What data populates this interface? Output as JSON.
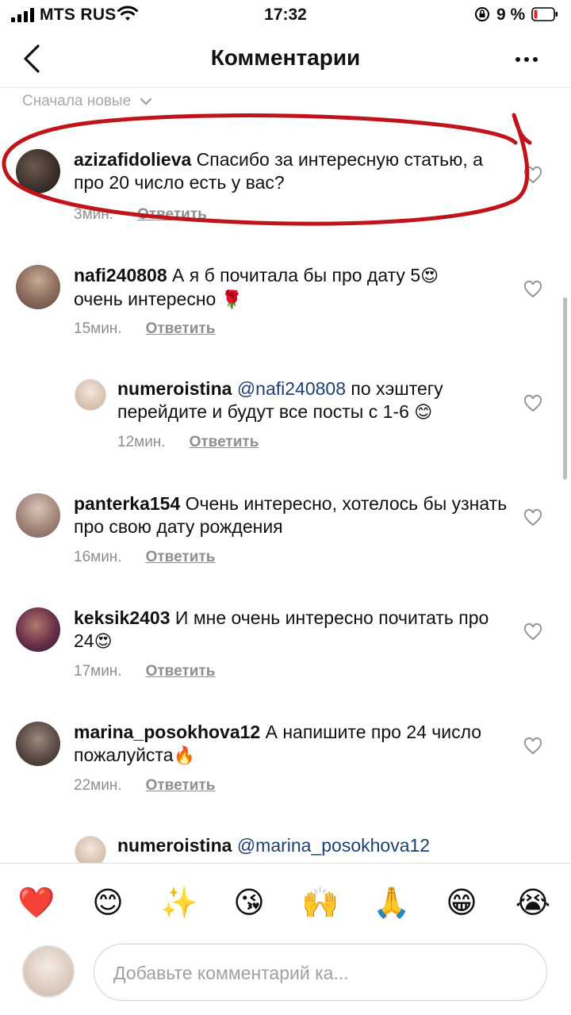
{
  "status": {
    "carrier": "MTS RUS",
    "time": "17:32",
    "battery": "9 %"
  },
  "header": {
    "title": "Комментарии",
    "back_icon": "chevron-left-icon",
    "more_icon": "more-horizontal-icon"
  },
  "sort": {
    "label": "Сначала новые"
  },
  "comments": [
    {
      "user": "azizafidolieva",
      "mention": "",
      "text": "Спасибо за интересную статью, а про 20 число есть у вас?",
      "emoji": "",
      "time": "3мин.",
      "reply": "Ответить"
    },
    {
      "user": "nafi240808",
      "mention": "",
      "text": "А я б почитала бы про дату 5",
      "text2": "очень интересно",
      "emoji": "😍",
      "emoji2": "🌹",
      "time": "15мин.",
      "reply": "Ответить"
    },
    {
      "user": "numeroistina",
      "mention": "@nafi240808",
      "text": "по хэштегу перейдите и будут все посты с 1-6",
      "emoji": "😊",
      "time": "12мин.",
      "reply": "Ответить"
    },
    {
      "user": "panterka154",
      "mention": "",
      "text": "Очень интересно, хотелось бы узнать про свою дату рождения",
      "emoji": "",
      "time": "16мин.",
      "reply": "Ответить"
    },
    {
      "user": "keksik2403",
      "mention": "",
      "text": "И мне очень интересно почитать про 24",
      "emoji": "😍",
      "time": "17мин.",
      "reply": "Ответить"
    },
    {
      "user": "marina_posokhova12",
      "mention": "",
      "text": "А напишите про 24 число пожалуйста",
      "emoji": "🔥",
      "time": "22мин.",
      "reply": "Ответить"
    },
    {
      "user": "numeroistina",
      "mention": "@marina_posokhova12",
      "text": "",
      "emoji": "",
      "time": "",
      "reply": ""
    }
  ],
  "emoji_bar": [
    "❤️",
    "😊",
    "✨",
    "😘",
    "🙌",
    "🙏",
    "😁",
    "😭"
  ],
  "composer": {
    "placeholder": "Добавьте комментарий ка..."
  },
  "colors": {
    "annotation": "#c0141a",
    "mention": "#1b3f7a",
    "muted": "#8e8e8e"
  }
}
